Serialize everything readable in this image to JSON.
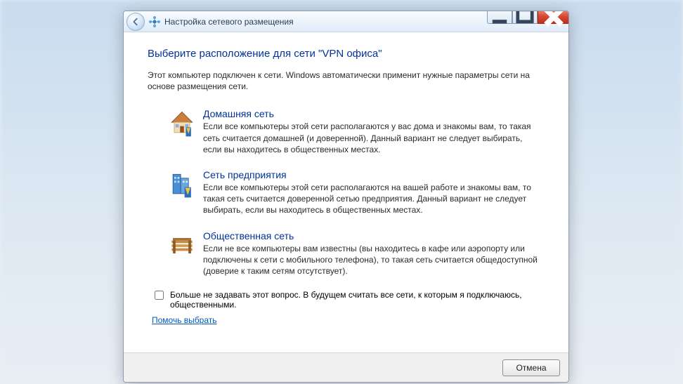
{
  "titlebar": {
    "title": "Настройка сетевого размещения"
  },
  "heading": "Выберите расположение для сети \"VPN офиса\"",
  "intro": "Этот компьютер подключен к сети. Windows автоматически применит нужные параметры сети на основе размещения сети.",
  "options": [
    {
      "title": "Домашняя сеть",
      "desc": "Если все компьютеры этой сети располагаются у вас дома и знакомы вам, то такая сеть считается домашней (и доверенной). Данный вариант не следует выбирать, если вы находитесь в общественных местах."
    },
    {
      "title": "Сеть предприятия",
      "desc": "Если все компьютеры этой сети располагаются на вашей работе и знакомы вам, то такая сеть считается доверенной сетью предприятия. Данный вариант не следует выбирать, если вы находитесь в общественных местах."
    },
    {
      "title": "Общественная сеть",
      "desc": "Если не все компьютеры вам известны (вы находитесь в кафе или аэропорту или подключены к сети с мобильного телефона), то такая сеть считается общедоступной (доверие к таким сетям отсутствует)."
    }
  ],
  "checkbox_label": "Больше не задавать этот вопрос. В будущем считать все сети, к которым я подключаюсь, общественными.",
  "help_link": "Помочь выбрать",
  "footer": {
    "cancel": "Отмена"
  }
}
